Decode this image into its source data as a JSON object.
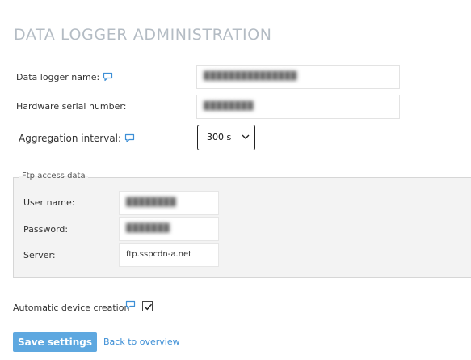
{
  "page": {
    "title": "DATA LOGGER ADMINISTRATION"
  },
  "form": {
    "logger_name_label": "Data logger name:",
    "logger_name_value": "███████████████",
    "serial_label": "Hardware serial number:",
    "serial_value": "████████",
    "aggregation_label": "Aggregation interval:",
    "aggregation_value": "300 s"
  },
  "ftp": {
    "legend": "Ftp access data",
    "user_label": "User name:",
    "user_value": "████████",
    "password_label": "Password:",
    "password_value": "███████",
    "server_label": "Server:",
    "server_value": "ftp.sspcdn-a.net"
  },
  "options": {
    "auto_device_label": "Automatic device creation",
    "auto_device_checked": true
  },
  "actions": {
    "save_label": "Save settings",
    "back_label": "Back to overview"
  },
  "colors": {
    "accent": "#5ea8e0",
    "link": "#3d8fd6",
    "title": "#b4bcc4"
  }
}
